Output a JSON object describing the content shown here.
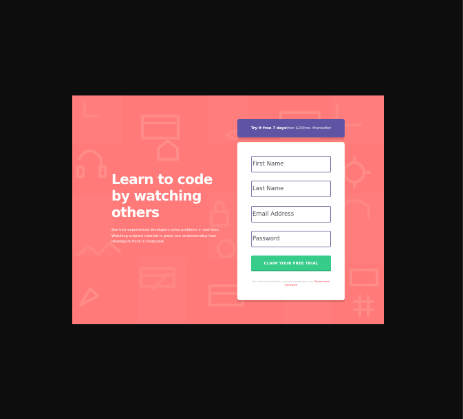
{
  "window": {
    "background": "#0d0d0d"
  },
  "hero": {
    "title": "Learn to code by watching others",
    "description": "See how experienced developers solve problems in real-time. Watching scripted tutorials is great, but understanding how developers think is invaluable."
  },
  "trial": {
    "strong": "Try it free 7 days",
    "rest": "then $20/mo. thereafter",
    "color": "#5e54a4"
  },
  "form": {
    "first_name_placeholder": "First Name",
    "last_name_placeholder": "Last Name",
    "email_placeholder": "Email Address",
    "password_placeholder": "Password",
    "submit_label": "CLAIM YOUR FREE TRIAL",
    "submit_color": "#38cc8b",
    "terms_prefix": "By clicking the button, you are agreeing to our",
    "terms_link": "Terms and Services",
    "terms_color": "#ff7a79"
  },
  "colors": {
    "panel": "#ff7a79",
    "card": "#ffffff",
    "accent_blue": "#5e54a4",
    "accent_green": "#38cc8b"
  },
  "icons": {
    "background_pattern": "coding-icons-pattern",
    "trial_banner": "banner",
    "submit": "button"
  }
}
